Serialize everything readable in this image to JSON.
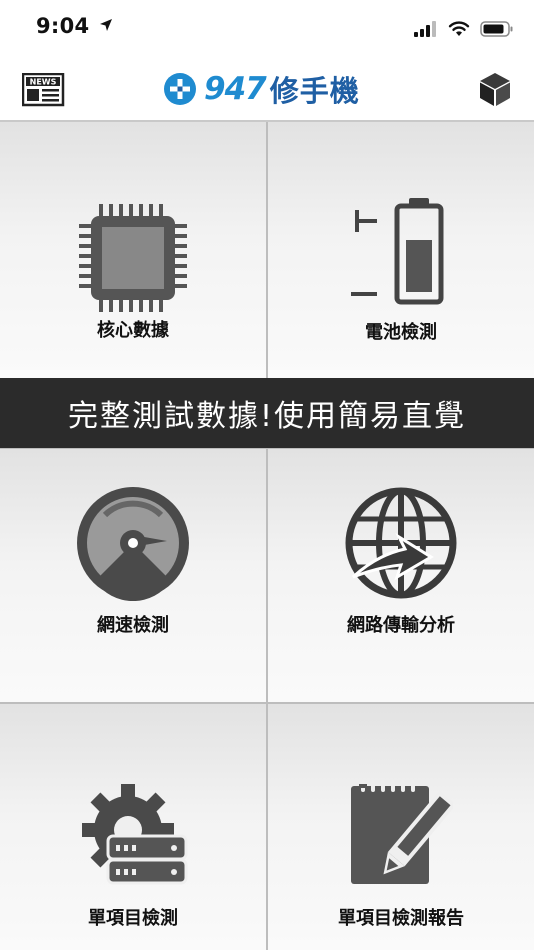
{
  "status": {
    "time": "9:04"
  },
  "header": {
    "brand_number": "947",
    "brand_name": "修手機"
  },
  "tiles": [
    {
      "label": "核心數據"
    },
    {
      "label": "電池檢測"
    },
    {
      "label": "網速檢測"
    },
    {
      "label": "網路傳輸分析"
    },
    {
      "label": "單項目檢測"
    },
    {
      "label": "單項目檢測報告"
    }
  ],
  "banner": {
    "text": "完整測試數據!使用簡易直覺"
  },
  "icons": {
    "news": "news-icon",
    "box": "cube-icon",
    "tile_0": "cpu-chip-icon",
    "tile_1": "battery-icon",
    "tile_2": "speedometer-icon",
    "tile_3": "globe-network-icon",
    "tile_4": "gear-server-icon",
    "tile_5": "notepad-pencil-icon"
  },
  "colors": {
    "brand_blue": "#1f8bd0",
    "brand_dark_blue": "#1f5fa4",
    "banner_bg": "#2b2b2b",
    "icon_gray": "#555555"
  }
}
